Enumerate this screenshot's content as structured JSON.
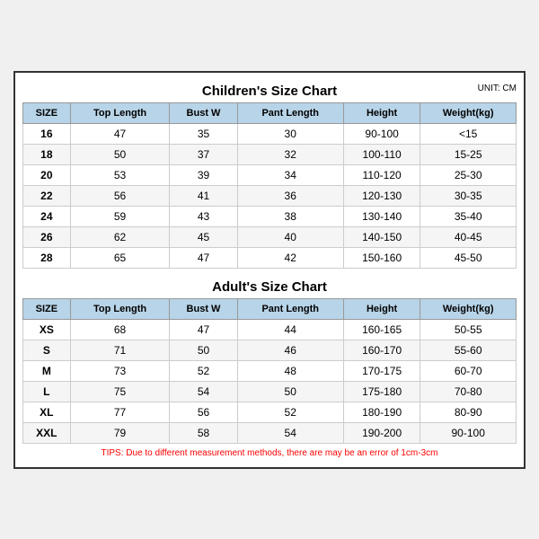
{
  "children_title": "Children's Size Chart",
  "adult_title": "Adult's Size Chart",
  "unit": "UNIT: CM",
  "tips": "TIPS: Due to different measurement methods, there are may be an error of 1cm-3cm",
  "columns": [
    "SIZE",
    "Top Length",
    "Bust W",
    "Pant Length",
    "Height",
    "Weight(kg)"
  ],
  "children_rows": [
    [
      "16",
      "47",
      "35",
      "30",
      "90-100",
      "<15"
    ],
    [
      "18",
      "50",
      "37",
      "32",
      "100-110",
      "15-25"
    ],
    [
      "20",
      "53",
      "39",
      "34",
      "110-120",
      "25-30"
    ],
    [
      "22",
      "56",
      "41",
      "36",
      "120-130",
      "30-35"
    ],
    [
      "24",
      "59",
      "43",
      "38",
      "130-140",
      "35-40"
    ],
    [
      "26",
      "62",
      "45",
      "40",
      "140-150",
      "40-45"
    ],
    [
      "28",
      "65",
      "47",
      "42",
      "150-160",
      "45-50"
    ]
  ],
  "adult_rows": [
    [
      "XS",
      "68",
      "47",
      "44",
      "160-165",
      "50-55"
    ],
    [
      "S",
      "71",
      "50",
      "46",
      "160-170",
      "55-60"
    ],
    [
      "M",
      "73",
      "52",
      "48",
      "170-175",
      "60-70"
    ],
    [
      "L",
      "75",
      "54",
      "50",
      "175-180",
      "70-80"
    ],
    [
      "XL",
      "77",
      "56",
      "52",
      "180-190",
      "80-90"
    ],
    [
      "XXL",
      "79",
      "58",
      "54",
      "190-200",
      "90-100"
    ]
  ]
}
